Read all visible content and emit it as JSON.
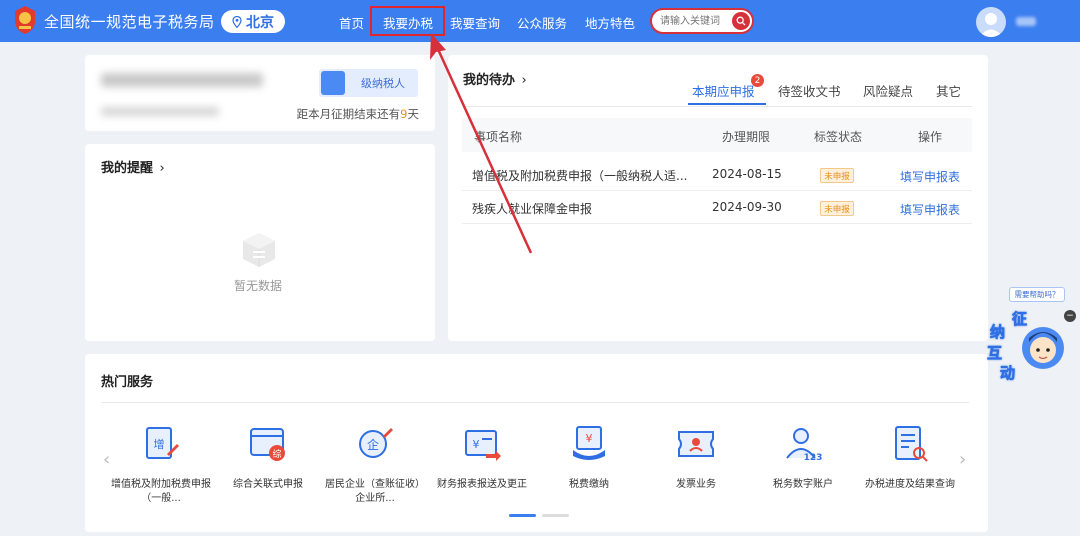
{
  "header": {
    "site_title": "全国统一规范电子税务局",
    "region": "北京",
    "nav": [
      "首页",
      "我要办税",
      "我要查询",
      "公众服务",
      "地方特色"
    ],
    "search_placeholder": "请输入关键词",
    "icons": {
      "logo": "tax-emblem-icon",
      "region": "location-pin-icon",
      "search": "search-icon",
      "avatar": "user-avatar-icon"
    }
  },
  "profile": {
    "taxpayer_type": "级纳税人",
    "deadline_prefix": "距本月征期结束还有",
    "deadline_days": "9",
    "deadline_suffix": "天"
  },
  "reminder": {
    "title": "我的提醒",
    "title_chevron": "›",
    "empty_text": "暂无数据",
    "empty_icon": "empty-box-icon"
  },
  "todo": {
    "title": "我的待办",
    "title_chevron": "›",
    "tabs": [
      {
        "label": "本期应申报",
        "badge": "2",
        "active": true
      },
      {
        "label": "待签收文书"
      },
      {
        "label": "风险疑点"
      },
      {
        "label": "其它"
      }
    ],
    "columns": [
      "事项名称",
      "办理期限",
      "标签状态",
      "操作"
    ],
    "rows": [
      {
        "name": "增值税及附加税费申报（一般纳税人适...",
        "deadline": "2024-08-15",
        "status": "未申报",
        "action": "填写申报表"
      },
      {
        "name": "残疾人就业保障金申报",
        "deadline": "2024-09-30",
        "status": "未申报",
        "action": "填写申报表"
      }
    ]
  },
  "hot_services": {
    "title": "热门服务",
    "prev": "‹",
    "next": "›",
    "items": [
      {
        "label": "增值税及附加税费申报（一般...",
        "icon": "vat-declare-icon",
        "icon_char": "增"
      },
      {
        "label": "综合关联式申报",
        "icon": "browser-window-icon",
        "icon_char": "综"
      },
      {
        "label": "居民企业（查账征收）企业所...",
        "icon": "enterprise-pen-icon",
        "icon_char": "企"
      },
      {
        "label": "财务报表报送及更正",
        "icon": "financial-report-icon",
        "icon_char": "≡"
      },
      {
        "label": "税费缴纳",
        "icon": "tax-payment-icon",
        "icon_char": "¥"
      },
      {
        "label": "发票业务",
        "icon": "ticket-icon",
        "icon_char": "⌂"
      },
      {
        "label": "税务数字账户",
        "icon": "digital-account-icon",
        "icon_char": "123"
      },
      {
        "label": "办税进度及结果查询",
        "icon": "progress-search-icon",
        "icon_char": "≡"
      }
    ]
  },
  "assistant": {
    "bubble": "需要帮助吗？",
    "close": "−",
    "chars": [
      "征",
      "纳",
      "互",
      "动"
    ]
  },
  "colors": {
    "header_blue": "#3b7ef0",
    "link_blue": "#2f6fe4",
    "highlight_red": "#e0262b",
    "status_orange": "#e8901c"
  }
}
